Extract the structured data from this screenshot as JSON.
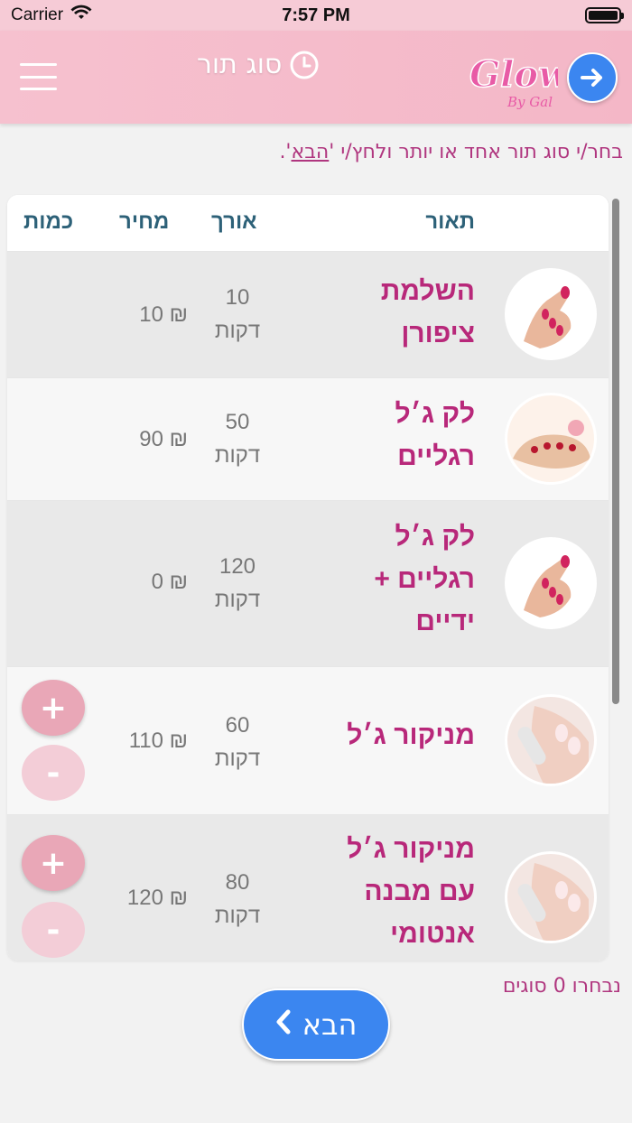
{
  "status_bar": {
    "carrier": "Carrier",
    "time": "7:57 PM"
  },
  "header": {
    "title": "סוג תור",
    "logo_text": "Glow",
    "logo_sub": "By Gal"
  },
  "instruction": {
    "prefix": "בחר/י סוג תור אחד או יותר ולחץ/י '",
    "link": "הבא",
    "suffix": "'."
  },
  "table": {
    "headers": {
      "description": "תאור",
      "duration": "אורך",
      "price": "מחיר",
      "quantity": "כמות"
    },
    "rows": [
      {
        "name_line1": "השלמת",
        "name_line2": "ציפורן",
        "name_line3": "",
        "duration_num": "10",
        "duration_unit": "דקות",
        "price": "10 ₪",
        "thumb": "hand-nails-image",
        "has_qty": false
      },
      {
        "name_line1": "לק ג׳ל",
        "name_line2": "רגליים",
        "name_line3": "",
        "duration_num": "50",
        "duration_unit": "דקות",
        "price": "90 ₪",
        "thumb": "feet-nails-image",
        "has_qty": false
      },
      {
        "name_line1": "לק ג׳ל",
        "name_line2": "רגליים +",
        "name_line3": "ידיים",
        "duration_num": "120",
        "duration_unit": "דקות",
        "price": "0 ₪",
        "thumb": "hand-nails-image",
        "has_qty": false
      },
      {
        "name_line1": "מניקור ג׳ל",
        "name_line2": "",
        "name_line3": "",
        "duration_num": "60",
        "duration_unit": "דקות",
        "price": "110 ₪",
        "thumb": "manicure-file-image",
        "has_qty": true,
        "plus_label": "+",
        "minus_label": "-"
      },
      {
        "name_line1": "מניקור ג׳ל",
        "name_line2": "עם מבנה",
        "name_line3": "אנטומי",
        "duration_num": "80",
        "duration_unit": "דקות",
        "price": "120 ₪",
        "thumb": "manicure-file-image",
        "has_qty": true,
        "plus_label": "+",
        "minus_label": "-"
      }
    ]
  },
  "footer": {
    "selected_count": "נבחרו 0 סוגים",
    "next_label": "הבא"
  },
  "colors": {
    "accent_pink": "#b8287a",
    "header_bg": "#f6c1cf",
    "button_blue": "#3b86f0",
    "table_header_text": "#2d6178"
  }
}
